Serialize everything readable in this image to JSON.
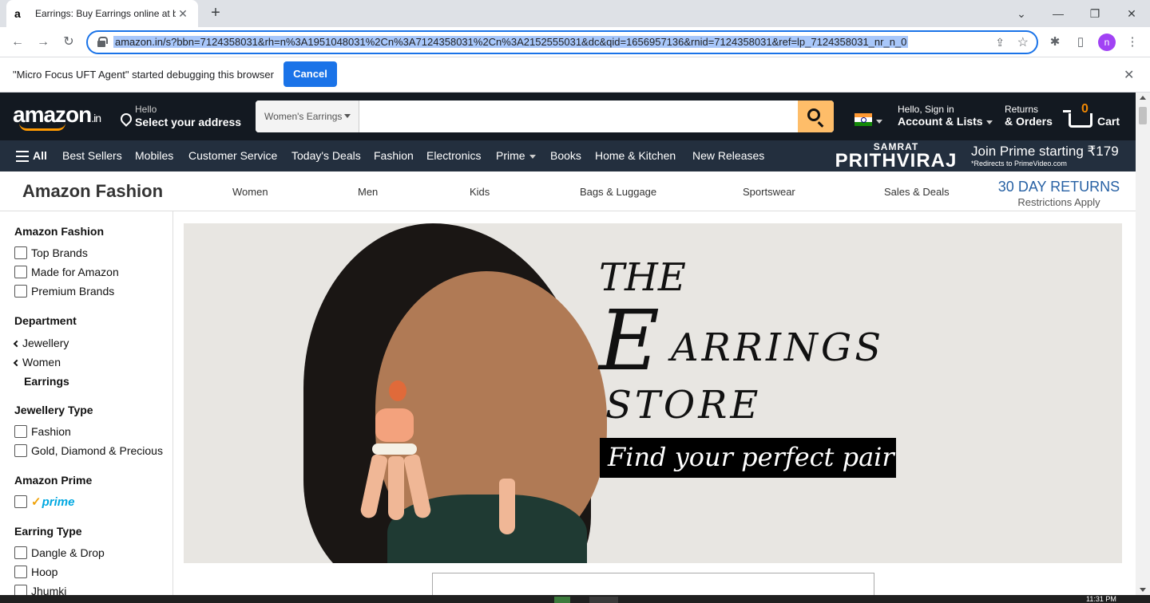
{
  "browser": {
    "tab_title": "Earrings: Buy Earrings online at b",
    "tab_favicon": "a",
    "url": "amazon.in/s?bbn=7124358031&rh=n%3A1951048031%2Cn%3A7124358031%2Cn%3A2152555031&dc&qid=1656957136&rnid=7124358031&ref=lp_7124358031_nr_n_0",
    "profile_initial": "n",
    "accent": "#1a73e8"
  },
  "infobar": {
    "message": "\"Micro Focus UFT Agent\" started debugging this browser",
    "cancel_label": "Cancel"
  },
  "header": {
    "logo": "amazon",
    "logo_suffix": ".in",
    "address_line1": "Hello",
    "address_line2": "Select your address",
    "search_category": "Women's Earrings",
    "search_value": "",
    "account_line1": "Hello, Sign in",
    "account_line2": "Account & Lists",
    "orders_line1": "Returns",
    "orders_line2": "& Orders",
    "cart_count": "0",
    "cart_label": "Cart"
  },
  "nav": {
    "all_label": "All",
    "items": [
      "Best Sellers",
      "Mobiles",
      "Customer Service",
      "Today's Deals",
      "Fashion",
      "Electronics",
      "Prime",
      "Books",
      "Home & Kitchen",
      "New Releases"
    ],
    "promo_small": "SAMRAT",
    "promo_big": "PRITHVIRAJ",
    "promo_offer": "Join Prime starting ₹179",
    "promo_note": "*Redirects to PrimeVideo.com"
  },
  "subnav": {
    "brand": "Amazon Fashion",
    "links": [
      "Women",
      "Men",
      "Kids",
      "Bags & Luggage",
      "Sportswear",
      "Sales & Deals"
    ],
    "returns_title": "30 DAY RETURNS",
    "returns_note": "Restrictions Apply"
  },
  "sidebar": {
    "fashion_heading": "Amazon Fashion",
    "fashion_options": [
      "Top Brands",
      "Made for Amazon",
      "Premium Brands"
    ],
    "department_heading": "Department",
    "department_back": [
      "Jewellery",
      "Women"
    ],
    "department_selected": "Earrings",
    "jewellery_heading": "Jewellery Type",
    "jewellery_options": [
      "Fashion",
      "Gold, Diamond & Precious"
    ],
    "prime_heading": "Amazon Prime",
    "prime_label": "prime",
    "earring_heading": "Earring Type",
    "earring_options": [
      "Dangle & Drop",
      "Hoop",
      "Jhumki"
    ]
  },
  "banner": {
    "line1": "THE",
    "line2_initial": "E",
    "line2_rest": "ARRINGS",
    "line3": "STORE",
    "tagline": "Find your perfect pair"
  },
  "taskbar": {
    "time": "11:31 PM"
  }
}
